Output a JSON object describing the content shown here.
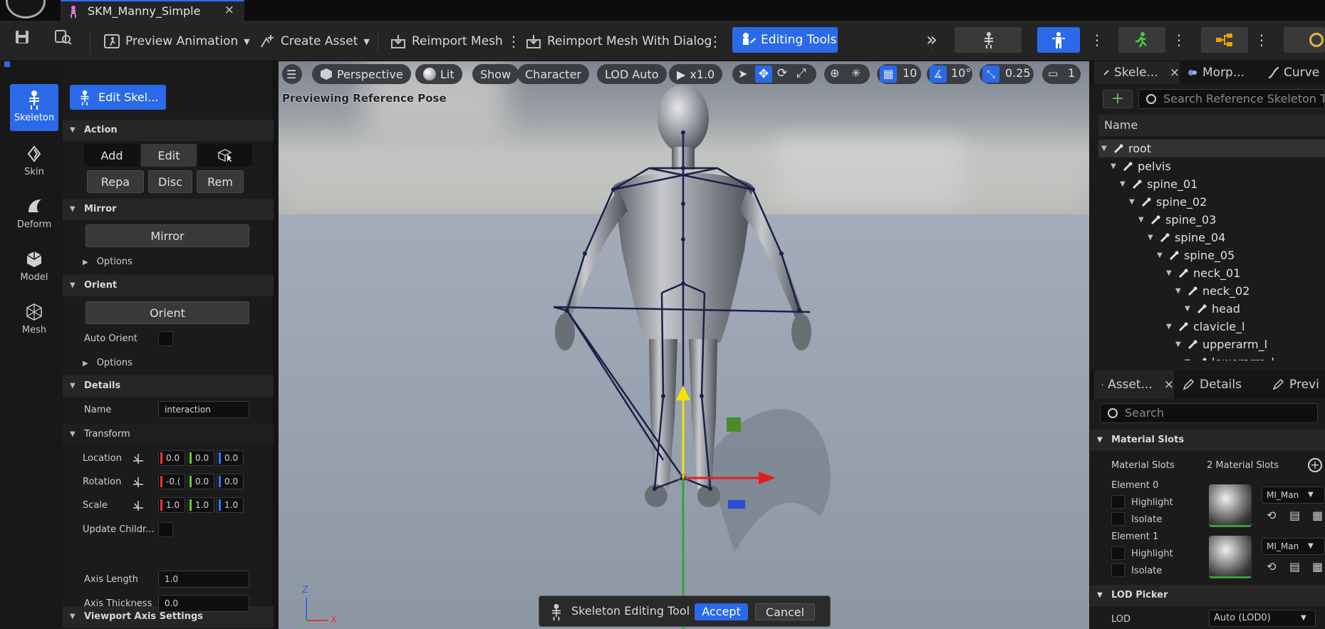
{
  "window": {
    "tab_title": "SKM_Manny_Simple",
    "tab_close": "×"
  },
  "toolbar": {
    "preview_animation": "Preview Animation",
    "create_asset": "Create Asset",
    "reimport_mesh": "Reimport Mesh",
    "reimport_with_dialog": "Reimport Mesh With Dialog",
    "editing_tools": "Editing Tools",
    "overflow": "»",
    "accent": "#2a6ae8"
  },
  "modes": [
    {
      "label": "Skeleton",
      "icon": "skeleton-icon",
      "active": true
    },
    {
      "label": "Skin",
      "icon": "skin-icon"
    },
    {
      "label": "Deform",
      "icon": "deform-icon"
    },
    {
      "label": "Model",
      "icon": "model-icon"
    },
    {
      "label": "Mesh",
      "icon": "mesh-icon"
    }
  ],
  "tool_panel": {
    "edit_skeleton_button": "Edit Skel...",
    "action": {
      "title": "Action",
      "add": "Add",
      "edit": "Edit",
      "repair": "Repa",
      "disconnect": "Disc",
      "remove": "Rem"
    },
    "mirror": {
      "title": "Mirror",
      "button": "Mirror",
      "options": "Options"
    },
    "orient": {
      "title": "Orient",
      "button": "Orient",
      "auto_orient": "Auto Orient",
      "options": "Options"
    },
    "details": {
      "title": "Details",
      "name_label": "Name",
      "name_value": "interaction"
    },
    "transform": {
      "title": "Transform",
      "location_label": "Location",
      "location": [
        "0.0",
        "0.0",
        "0.0"
      ],
      "rotation_label": "Rotation",
      "rotation": [
        "-0.(",
        "0.0",
        "0.0"
      ],
      "scale_label": "Scale",
      "scale": [
        "1.0",
        "1.0",
        "1.0"
      ],
      "update_children_label": "Update Childr..."
    },
    "viewport_axis": {
      "title": "Viewport Axis Settings",
      "axis_length_label": "Axis Length",
      "axis_length": "1.0",
      "axis_thickness_label": "Axis Thickness",
      "axis_thickness": "0.0"
    }
  },
  "viewport": {
    "perspective": "Perspective",
    "lit": "Lit",
    "show": "Show",
    "character": "Character",
    "lod": "LOD Auto",
    "play_speed": "x1.0",
    "grid_snap": "10",
    "rotation_snap": "10°",
    "scale_snap": "0.25",
    "camera_speed": "1",
    "preview_label": "Previewing Reference Pose",
    "tool_name": "Skeleton Editing Tool",
    "accept": "Accept",
    "cancel": "Cancel",
    "axis_z": "Z",
    "axis_x": "X"
  },
  "skeleton_panel": {
    "tabs": [
      "Skele...",
      "Morp...",
      "Curve"
    ],
    "close": "×",
    "search_placeholder": "Search Reference Skeleton Tree",
    "column_name": "Name",
    "bones": [
      {
        "name": "root",
        "depth": 0
      },
      {
        "name": "pelvis",
        "depth": 1
      },
      {
        "name": "spine_01",
        "depth": 2
      },
      {
        "name": "spine_02",
        "depth": 3
      },
      {
        "name": "spine_03",
        "depth": 4
      },
      {
        "name": "spine_04",
        "depth": 5
      },
      {
        "name": "spine_05",
        "depth": 6
      },
      {
        "name": "neck_01",
        "depth": 7
      },
      {
        "name": "neck_02",
        "depth": 8
      },
      {
        "name": "head",
        "depth": 9
      },
      {
        "name": "clavicle_l",
        "depth": 7
      },
      {
        "name": "upperarm_l",
        "depth": 8
      },
      {
        "name": "lowerarm_l",
        "depth": 9
      }
    ]
  },
  "details_panel": {
    "tabs": [
      "Asset...",
      "Details",
      "Previ"
    ],
    "close": "×",
    "search_placeholder": "Search",
    "material_slots_section": "Material Slots",
    "material_slots_label": "Material Slots",
    "material_slots_count": "2 Material Slots",
    "elements": [
      {
        "label": "Element 0",
        "highlight": "Highlight",
        "isolate": "Isolate",
        "material": "MI_Man"
      },
      {
        "label": "Element 1",
        "highlight": "Highlight",
        "isolate": "Isolate",
        "material": "MI_Man"
      }
    ],
    "lod_picker_section": "LOD Picker",
    "lod_label": "LOD",
    "lod_value": "Auto (LOD0)"
  }
}
